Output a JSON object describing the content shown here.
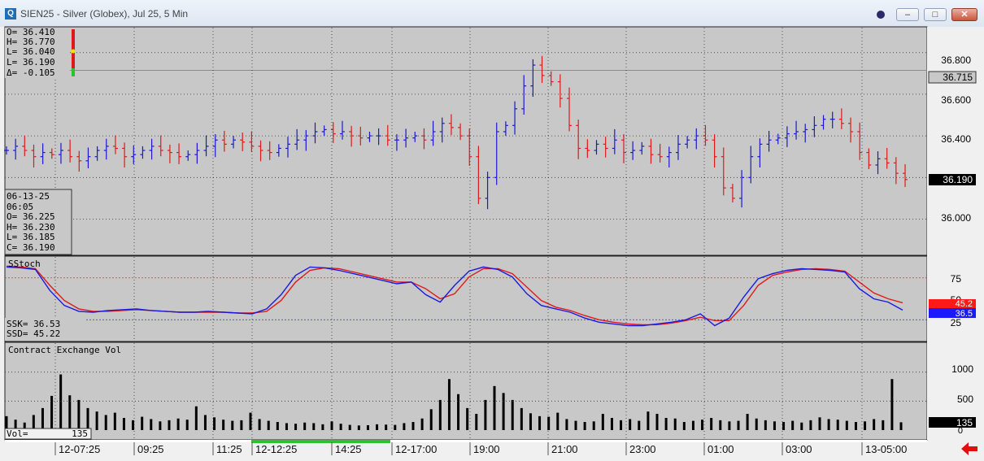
{
  "window": {
    "title": "SIEN25 - Silver (Globex), Jul 25, 5 Min",
    "icon_letter": "Q",
    "buttons": [
      "dot",
      "minimize",
      "restore",
      "close"
    ]
  },
  "ohlc_box": {
    "o": "O=  36.410",
    "h": "H=  36.770",
    "l1": "L=  36.040",
    "l2": "L=  36.190",
    "delta": "Δ=  -0.105"
  },
  "bar_box": {
    "date": "06-13-25",
    "time": "06:05",
    "o": "O=   36.225",
    "h": "H=   36.230",
    "l": "L=   36.185",
    "c": "C=   36.190"
  },
  "stoch": {
    "label": "SStoch",
    "ssk": "SSK=    36.53",
    "ssd": "SSD=    45.22",
    "ssd_flag": "45.2",
    "ssk_flag": "36.5"
  },
  "volume": {
    "label": "Contract Exchange Vol",
    "readout": "Vol=",
    "readout_value": "135",
    "flag": "135"
  },
  "price_axis": {
    "ticks": [
      "36.800",
      "36.600",
      "36.400",
      "36.000"
    ],
    "ref_flag": "36.715",
    "last_flag": "36.190"
  },
  "stoch_axis": {
    "ticks": [
      "75",
      "50",
      "25"
    ]
  },
  "vol_axis": {
    "ticks": [
      "1000",
      "500",
      "0"
    ]
  },
  "time_axis": [
    "12-07:25",
    "09:25",
    "11:25",
    "12-12:25",
    "14:25",
    "12-17:00",
    "19:00",
    "21:00",
    "23:00",
    "01:00",
    "03:00",
    "13-05:00"
  ],
  "colors": {
    "up": "#1a1acc",
    "down": "#dd1a1a",
    "panel": "#c8c8c8",
    "accent_green": "#2fbf2f"
  },
  "chart_data": {
    "type": "ohlc",
    "price_ylim": [
      35.83,
      36.92
    ],
    "price_closes": [
      36.33,
      36.35,
      36.33,
      36.3,
      36.32,
      36.31,
      36.33,
      36.3,
      36.28,
      36.3,
      36.33,
      36.35,
      36.34,
      36.3,
      36.31,
      36.33,
      36.35,
      36.33,
      36.32,
      36.3,
      36.31,
      36.33,
      36.35,
      36.38,
      36.36,
      36.38,
      36.37,
      36.35,
      36.33,
      36.32,
      36.34,
      36.36,
      36.38,
      36.4,
      36.42,
      36.43,
      36.41,
      36.42,
      36.4,
      36.39,
      36.4,
      36.4,
      36.38,
      36.38,
      36.39,
      36.4,
      36.38,
      36.42,
      36.46,
      36.44,
      36.4,
      36.3,
      36.1,
      36.2,
      36.42,
      36.45,
      36.53,
      36.64,
      36.74,
      36.69,
      36.66,
      36.58,
      36.45,
      36.34,
      36.33,
      36.36,
      36.34,
      36.38,
      36.32,
      36.33,
      36.35,
      36.31,
      36.3,
      36.32,
      36.36,
      36.38,
      36.4,
      36.38,
      36.3,
      36.15,
      36.1,
      36.2,
      36.3,
      36.36,
      36.38,
      36.39,
      36.41,
      36.42,
      36.43,
      36.45,
      36.48,
      36.48,
      36.46,
      36.42,
      36.32,
      36.26,
      36.29,
      36.27,
      36.22,
      36.19
    ],
    "stoch_ylim": [
      0,
      100
    ],
    "ssk": [
      88,
      87,
      85,
      60,
      42,
      35,
      34,
      36,
      37,
      38,
      36,
      35,
      34,
      34,
      35,
      34,
      33,
      32,
      38,
      55,
      78,
      88,
      87,
      84,
      80,
      76,
      72,
      68,
      70,
      55,
      46,
      66,
      83,
      88,
      85,
      76,
      56,
      42,
      38,
      34,
      27,
      22,
      20,
      18,
      18,
      20,
      22,
      25,
      32,
      18,
      27,
      52,
      74,
      80,
      84,
      86,
      85,
      84,
      82,
      62,
      50,
      46,
      36.53
    ],
    "ssd": [
      89,
      88,
      86,
      66,
      48,
      38,
      35,
      35,
      36,
      37,
      36,
      35,
      34,
      34,
      34,
      34,
      33,
      33,
      35,
      48,
      70,
      84,
      87,
      86,
      82,
      78,
      74,
      70,
      70,
      62,
      50,
      56,
      76,
      86,
      86,
      80,
      64,
      48,
      40,
      36,
      30,
      25,
      22,
      20,
      19,
      19,
      21,
      24,
      28,
      24,
      24,
      42,
      66,
      78,
      82,
      85,
      86,
      85,
      83,
      70,
      57,
      50,
      45.22
    ],
    "stoch_levels": [
      75,
      50,
      25
    ],
    "vol_ylim": [
      0,
      1500
    ],
    "volume": [
      240,
      180,
      130,
      260,
      380,
      590,
      960,
      600,
      520,
      380,
      320,
      260,
      300,
      210,
      170,
      230,
      190,
      150,
      170,
      200,
      180,
      410,
      260,
      220,
      180,
      160,
      170,
      300,
      190,
      160,
      140,
      120,
      110,
      130,
      120,
      100,
      150,
      110,
      90,
      80,
      85,
      100,
      95,
      90,
      120,
      140,
      200,
      360,
      520,
      880,
      620,
      380,
      280,
      520,
      760,
      640,
      520,
      380,
      290,
      240,
      230,
      300,
      190,
      160,
      140,
      150,
      280,
      210,
      170,
      190,
      160,
      320,
      280,
      210,
      200,
      140,
      160,
      180,
      210,
      170,
      150,
      160,
      280,
      200,
      170,
      150,
      140,
      160,
      130,
      170,
      220,
      190,
      180,
      160,
      140,
      150,
      190,
      170,
      880,
      135
    ],
    "x_ticks": [
      "12-07:25",
      "09:25",
      "11:25",
      "12-12:25",
      "14:25",
      "12-17:00",
      "19:00",
      "21:00",
      "23:00",
      "01:00",
      "03:00",
      "13-05:00"
    ],
    "last": 36.19,
    "reference": 36.715
  }
}
